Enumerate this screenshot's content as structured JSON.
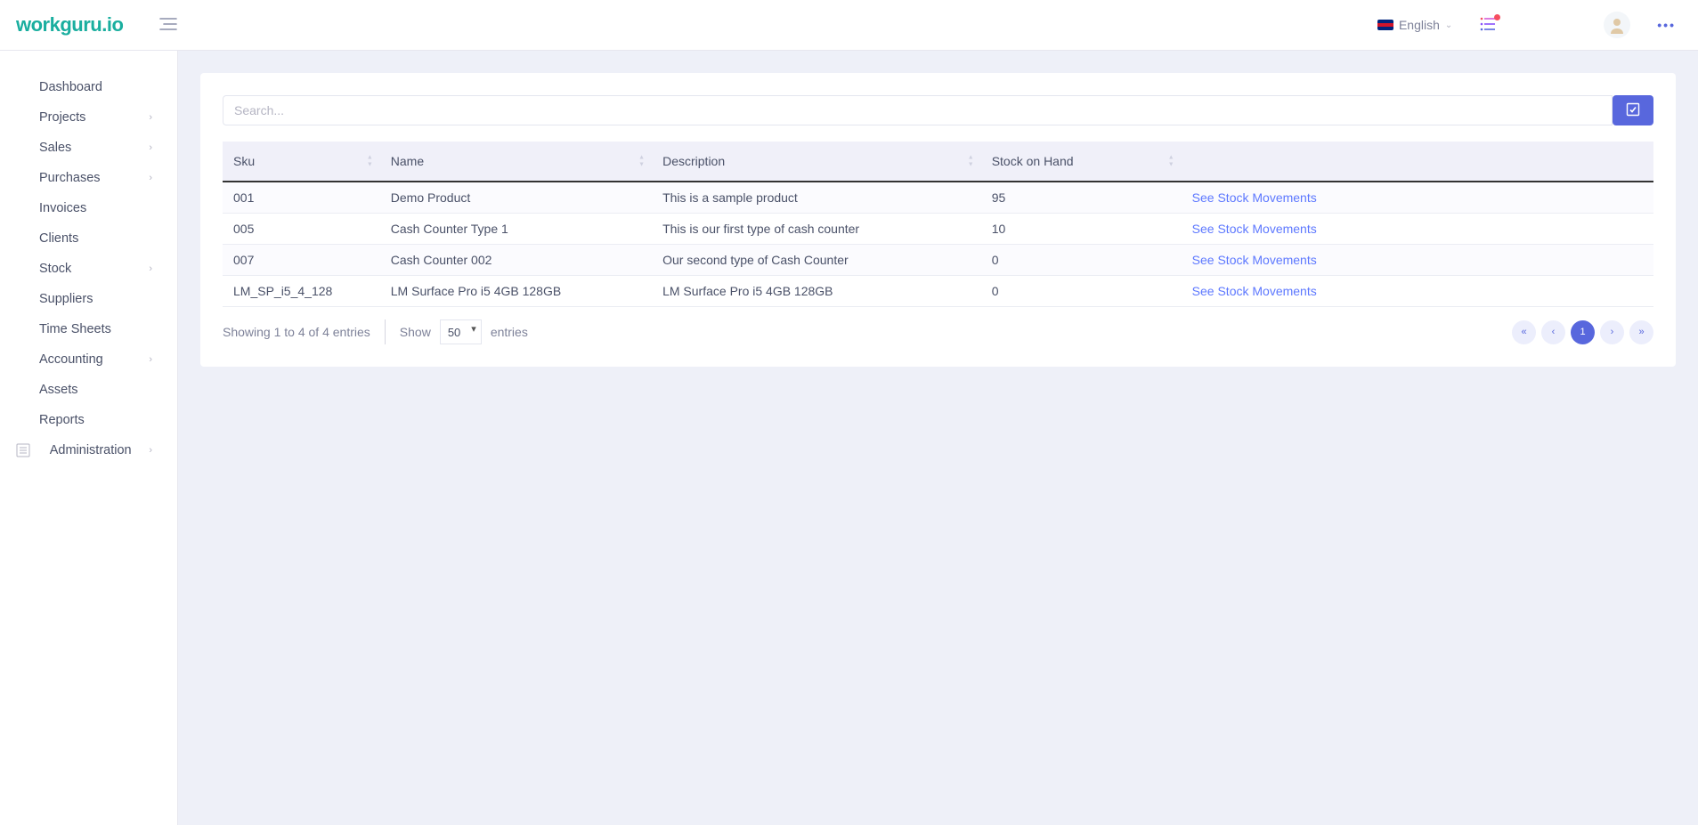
{
  "header": {
    "logo": "workguru.io",
    "language_label": "English"
  },
  "sidebar": {
    "items": [
      {
        "label": "Dashboard",
        "expandable": false
      },
      {
        "label": "Projects",
        "expandable": true
      },
      {
        "label": "Sales",
        "expandable": true
      },
      {
        "label": "Purchases",
        "expandable": true
      },
      {
        "label": "Invoices",
        "expandable": false
      },
      {
        "label": "Clients",
        "expandable": false
      },
      {
        "label": "Stock",
        "expandable": true
      },
      {
        "label": "Suppliers",
        "expandable": false
      },
      {
        "label": "Time Sheets",
        "expandable": false
      },
      {
        "label": "Accounting",
        "expandable": true
      },
      {
        "label": "Assets",
        "expandable": false
      },
      {
        "label": "Reports",
        "expandable": false
      },
      {
        "label": "Administration",
        "expandable": true,
        "icon": true
      }
    ]
  },
  "search": {
    "placeholder": "Search..."
  },
  "table": {
    "columns": [
      "Sku",
      "Name",
      "Description",
      "Stock on Hand",
      ""
    ],
    "rows": [
      {
        "sku": "001",
        "name": "Demo Product",
        "description": "This is a sample product",
        "soh": "95",
        "action": "See Stock Movements"
      },
      {
        "sku": "005",
        "name": "Cash Counter Type 1",
        "description": "This is our first type of cash counter",
        "soh": "10",
        "action": "See Stock Movements"
      },
      {
        "sku": "007",
        "name": "Cash Counter 002",
        "description": "Our second type of Cash Counter",
        "soh": "0",
        "action": "See Stock Movements"
      },
      {
        "sku": "LM_SP_i5_4_128",
        "name": "LM Surface Pro i5 4GB 128GB",
        "description": "LM Surface Pro i5 4GB 128GB",
        "soh": "0",
        "action": "See Stock Movements"
      }
    ]
  },
  "footer": {
    "showing": "Showing 1 to 4 of 4 entries",
    "show_label": "Show",
    "entries_label": "entries",
    "page_size": "50",
    "current_page": "1"
  }
}
